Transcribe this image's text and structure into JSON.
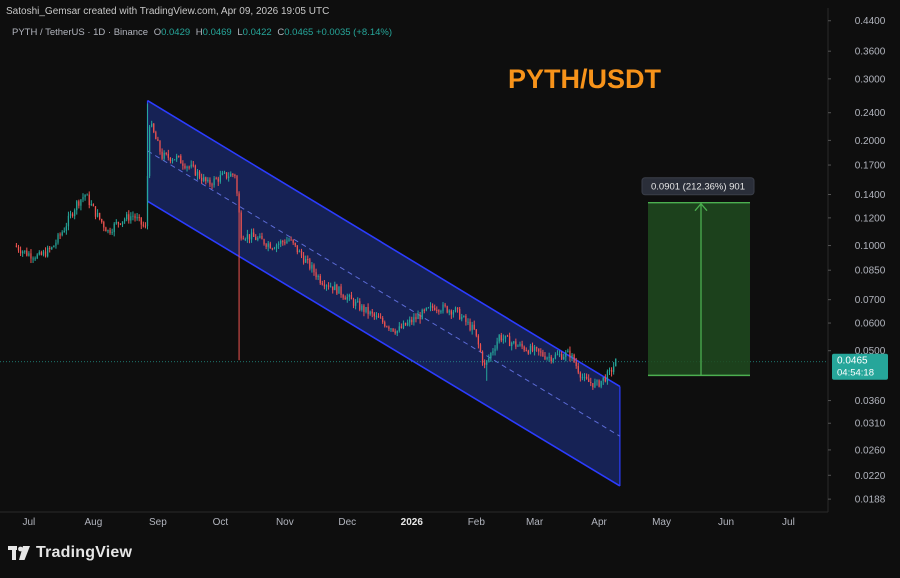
{
  "header": {
    "attribution": "Satoshi_Gemsar created with TradingView.com, Apr 09, 2026 19:05 UTC"
  },
  "legend": {
    "symbol": "PYTH / TetherUS · 1D · Binance",
    "o_label": "O",
    "o_value": "0.0429",
    "h_label": "H",
    "h_value": "0.0469",
    "l_label": "L",
    "l_value": "0.0422",
    "c_label": "C",
    "c_value": "0.0465",
    "change": "+0.0035 (+8.14%)"
  },
  "overlay_title": "PYTH/USDT",
  "measure_label": "0.0901 (212.36%) 901",
  "price_badge": {
    "price": "0.0465",
    "countdown": "04:54:18"
  },
  "footer": {
    "brand": "TradingView"
  },
  "colors": {
    "up": "#26a69a",
    "down": "#ef5350",
    "channel": "#2b3cff",
    "channel_fill": "#1a2a6e",
    "target_fill": "#1f4a1f",
    "target_line": "#4caf50",
    "title": "#f7931a"
  },
  "chart_data": {
    "type": "candlestick",
    "scale": "log",
    "y_ticks": [
      "0.4400",
      "0.3600",
      "0.3000",
      "0.2400",
      "0.2000",
      "0.1700",
      "0.1400",
      "0.1200",
      "0.1000",
      "0.0850",
      "0.0700",
      "0.0600",
      "0.0500",
      "0.0360",
      "0.0310",
      "0.0260",
      "0.0220",
      "0.0188"
    ],
    "x_ticks": [
      "Jul",
      "Aug",
      "Sep",
      "Oct",
      "Nov",
      "Dec",
      "2026",
      "Feb",
      "Mar",
      "Apr",
      "May",
      "Jun",
      "Jul"
    ],
    "ylim": [
      0.0175,
      0.46
    ],
    "current_price": 0.0465,
    "channel": {
      "upper": [
        {
          "x": "2025-08-27",
          "y": 0.26
        },
        {
          "x": "2026-04-11",
          "y": 0.0395
        }
      ],
      "lower": [
        {
          "x": "2025-08-27",
          "y": 0.134
        },
        {
          "x": "2026-04-11",
          "y": 0.0205
        }
      ]
    },
    "measure": {
      "from": 0.0425,
      "to": 0.1326,
      "change": 0.0901,
      "pct": 212.36,
      "bars": 901
    },
    "price_path": [
      [
        "2025-06-24",
        0.1
      ],
      [
        "2025-06-30",
        0.095
      ],
      [
        "2025-07-06",
        0.093
      ],
      [
        "2025-07-12",
        0.098
      ],
      [
        "2025-07-18",
        0.112
      ],
      [
        "2025-07-24",
        0.132
      ],
      [
        "2025-07-28",
        0.14
      ],
      [
        "2025-08-02",
        0.124
      ],
      [
        "2025-08-08",
        0.11
      ],
      [
        "2025-08-14",
        0.118
      ],
      [
        "2025-08-20",
        0.122
      ],
      [
        "2025-08-26",
        0.112
      ],
      [
        "2025-08-28",
        0.225
      ],
      [
        "2025-09-03",
        0.18
      ],
      [
        "2025-09-10",
        0.178
      ],
      [
        "2025-09-18",
        0.165
      ],
      [
        "2025-09-25",
        0.15
      ],
      [
        "2025-10-02",
        0.158
      ],
      [
        "2025-10-08",
        0.16
      ],
      [
        "2025-10-11",
        0.108
      ],
      [
        "2025-10-18",
        0.105
      ],
      [
        "2025-10-26",
        0.1
      ],
      [
        "2025-11-03",
        0.104
      ],
      [
        "2025-11-10",
        0.092
      ],
      [
        "2025-11-18",
        0.08
      ],
      [
        "2025-11-26",
        0.075
      ],
      [
        "2025-12-05",
        0.068
      ],
      [
        "2025-12-15",
        0.062
      ],
      [
        "2025-12-25",
        0.057
      ],
      [
        "2026-01-03",
        0.062
      ],
      [
        "2026-01-12",
        0.067
      ],
      [
        "2026-01-22",
        0.065
      ],
      [
        "2026-01-31",
        0.057
      ],
      [
        "2026-02-05",
        0.045
      ],
      [
        "2026-02-12",
        0.055
      ],
      [
        "2026-02-20",
        0.052
      ],
      [
        "2026-02-28",
        0.05
      ],
      [
        "2026-03-08",
        0.048
      ],
      [
        "2026-03-18",
        0.049
      ],
      [
        "2026-03-25",
        0.041
      ],
      [
        "2026-03-31",
        0.04
      ],
      [
        "2026-04-06",
        0.043
      ],
      [
        "2026-04-09",
        0.0465
      ]
    ]
  }
}
